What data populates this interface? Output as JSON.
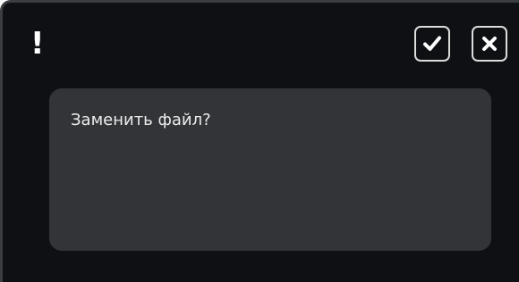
{
  "dialog": {
    "alert_mark": "!",
    "message": "Заменить файл?",
    "buttons": {
      "confirm_icon": "checkmark-icon",
      "cancel_icon": "close-icon"
    }
  },
  "colors": {
    "background": "#0e1013",
    "panel": "#323437",
    "text": "#ececec",
    "button_border": "#dcdcdc"
  }
}
